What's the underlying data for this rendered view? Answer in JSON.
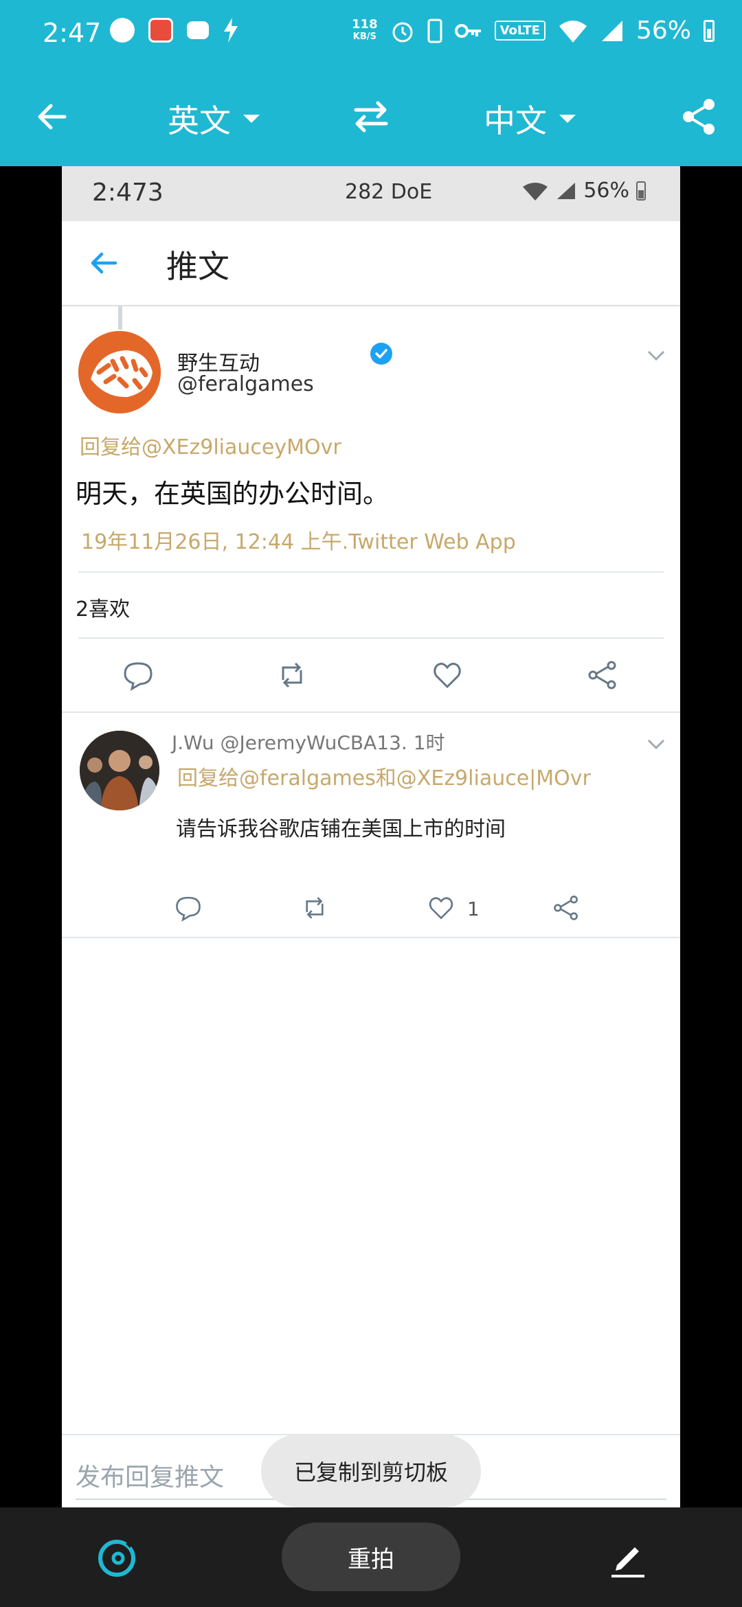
{
  "system_status": {
    "time": "2:47",
    "net_speed_value": "118",
    "net_speed_unit": "KB/S",
    "volte": "VoLTE",
    "battery": "56%"
  },
  "translate_bar": {
    "source_lang": "英文",
    "target_lang": "中文"
  },
  "inner_status": {
    "time": "2:473",
    "center": "282 DoE",
    "battery": "56%"
  },
  "appbar": {
    "title": "推文"
  },
  "tweet": {
    "name": "野生互动",
    "handle": "@feralgames",
    "reply_to": "回复给@XEz9liauceyMOvr",
    "text": "明天，在英国的办公时间。",
    "meta": "19年11月26日, 12:44 上午.Twitter Web App",
    "likes": "2喜欢"
  },
  "reply": {
    "header": "J.Wu @JeremyWuCBA13. 1时",
    "reply_to": "回复给@feralgames和@XEz9liauce|MOvr",
    "text": "请告诉我谷歌店铺在美国上市的时间",
    "like_count": "1"
  },
  "compose": {
    "placeholder": "发布回复推文"
  },
  "toast": {
    "text": "已复制到剪切板"
  },
  "bottom": {
    "retake_label": "重拍"
  },
  "colors": {
    "accent": "#1fb8d2",
    "twitter_blue": "#1da1f2",
    "gold_text": "#c7a86a"
  }
}
